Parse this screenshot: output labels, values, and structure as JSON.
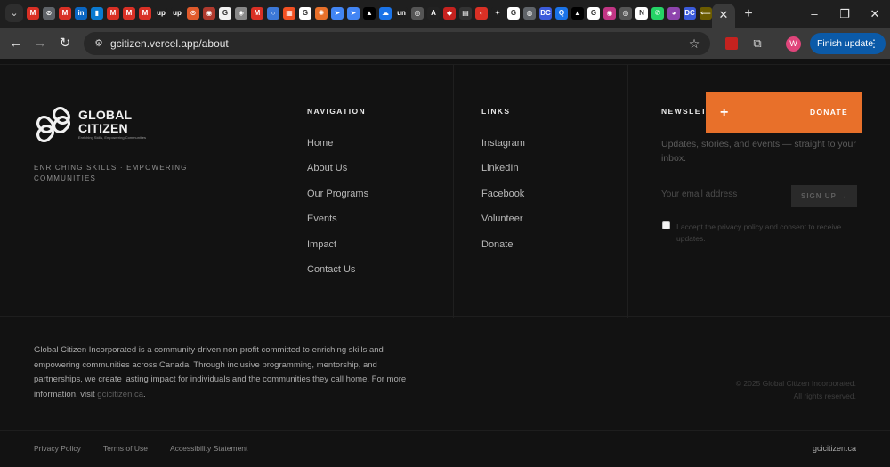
{
  "browser": {
    "active_tab_close": "✕",
    "new_tab": "+",
    "window": {
      "minimize": "–",
      "restore": "❐",
      "close": "✕"
    },
    "url": "gcitizen.vercel.app/about",
    "profile_initial": "W",
    "finish_update": "Finish update",
    "favicons": [
      {
        "label": "M",
        "color": "#d93025"
      },
      {
        "label": "⊘",
        "color": "#5f6368"
      },
      {
        "label": "M",
        "color": "#d93025"
      },
      {
        "label": "in",
        "color": "#0a66c2"
      },
      {
        "label": "▮",
        "color": "#0b7ad1"
      },
      {
        "label": "M",
        "color": "#d93025"
      },
      {
        "label": "M",
        "color": "#d93025"
      },
      {
        "label": "M",
        "color": "#d93025"
      },
      {
        "label": "up",
        "color": "#1f1f1f"
      },
      {
        "label": "up",
        "color": "#1f1f1f"
      },
      {
        "label": "⊙",
        "color": "#e05a2b"
      },
      {
        "label": "◉",
        "color": "#b03a2e"
      },
      {
        "label": "G",
        "color": "#f2f2f2"
      },
      {
        "label": "◈",
        "color": "#888888"
      },
      {
        "label": "M",
        "color": "#d93025"
      },
      {
        "label": "○",
        "color": "#3c78d8"
      },
      {
        "label": "▦",
        "color": "#f25022"
      },
      {
        "label": "G",
        "color": "#ffffff"
      },
      {
        "label": "✺",
        "color": "#e8702a"
      },
      {
        "label": "➤",
        "color": "#4285f4"
      },
      {
        "label": "➤",
        "color": "#4285f4"
      },
      {
        "label": "▲",
        "color": "#000000"
      },
      {
        "label": "☁",
        "color": "#1a73e8"
      },
      {
        "label": "un",
        "color": "#1f1f1f"
      },
      {
        "label": "◎",
        "color": "#555555"
      },
      {
        "label": "A",
        "color": "#222222"
      },
      {
        "label": "◆",
        "color": "#c5221f"
      },
      {
        "label": "▤",
        "color": "#333333"
      },
      {
        "label": "◐",
        "color": "#d93025"
      },
      {
        "label": "✦",
        "color": "#1f1f1f"
      },
      {
        "label": "G",
        "color": "#ffffff"
      },
      {
        "label": "◍",
        "color": "#5f6368"
      },
      {
        "label": "DC",
        "color": "#3b5bdb"
      },
      {
        "label": "Q",
        "color": "#1a73e8"
      },
      {
        "label": "▲",
        "color": "#000000"
      },
      {
        "label": "G",
        "color": "#ffffff"
      },
      {
        "label": "◉",
        "color": "#c13584"
      },
      {
        "label": "◎",
        "color": "#555555"
      },
      {
        "label": "N",
        "color": "#ffffff"
      },
      {
        "label": "✆",
        "color": "#25d366"
      },
      {
        "label": "◕",
        "color": "#8e44ad"
      },
      {
        "label": "DC",
        "color": "#3b5bdb"
      },
      {
        "label": "⟸",
        "color": "#6b5b00"
      }
    ]
  },
  "footer": {
    "logo": {
      "line1": "GLOBAL",
      "line2": "CITIZEN",
      "sub": "Enriching Skills, Empowering Communities"
    },
    "tagline": "ENRICHING SKILLS · EMPOWERING COMMUNITIES",
    "navigation": {
      "title": "NAVIGATION",
      "items": [
        "Home",
        "About Us",
        "Our Programs",
        "Events",
        "Impact",
        "Contact Us"
      ]
    },
    "links": {
      "title": "LINKS",
      "items": [
        "Instagram",
        "LinkedIn",
        "Facebook",
        "Volunteer",
        "Donate"
      ]
    },
    "newsletter": {
      "title": "NEWSLET",
      "description": "Updates, stories, and events — straight to your inbox.",
      "email_placeholder": "Your email address",
      "signup_label": "SIGN UP →",
      "consent": "I accept the privacy policy and consent to receive updates."
    },
    "donate": {
      "plus": "+",
      "label": "DONATE"
    },
    "about": {
      "text": "Global Citizen Incorporated is a community-driven non-profit committed to enriching skills and empowering communities across Canada. Through inclusive programming, mentorship, and partnerships, we create lasting impact for individuals and the communities they call home. For more information, visit",
      "link": "gcicitizen.ca",
      "end": "."
    },
    "copyright": {
      "line1": "© 2025 Global Citizen Incorporated.",
      "line2": "All rights reserved."
    },
    "legal": [
      "Privacy Policy",
      "Terms of Use",
      "Accessibility Statement"
    ],
    "domain": "gcicitizen.ca"
  }
}
